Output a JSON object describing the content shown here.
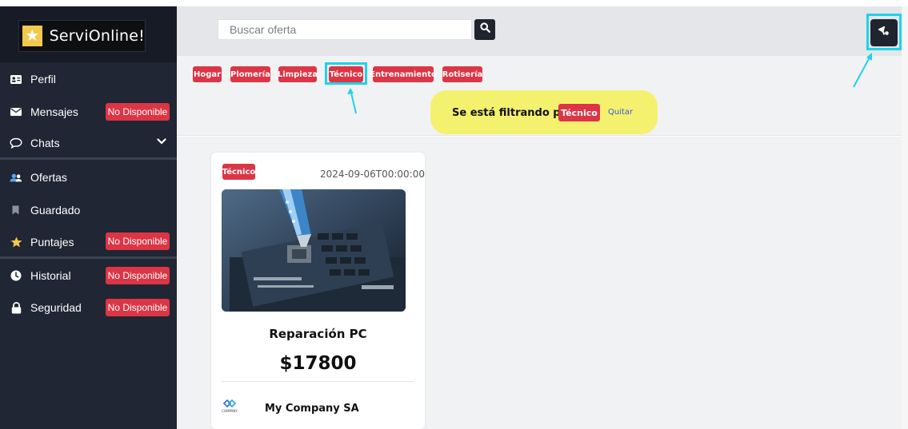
{
  "app": {
    "name": "ServiOnline!"
  },
  "colors": {
    "sidebar": "#202633",
    "accent": "#dc3545",
    "highlight_cyan": "#1dd3e8",
    "highlight_yellow": "#f4f16f"
  },
  "sidebar": {
    "items": [
      {
        "label": "Perfil",
        "icon": "id-card-icon"
      },
      {
        "label": "Mensajes",
        "icon": "envelope-icon",
        "badge": "No Disponible"
      },
      {
        "label": "Chats",
        "icon": "chat-bubble-icon"
      },
      {
        "label": "Ofertas",
        "icon": "users-icon"
      },
      {
        "label": "Guardado",
        "icon": "bookmark-icon"
      },
      {
        "label": "Puntajes",
        "icon": "star-icon",
        "badge": "No Disponible"
      },
      {
        "label": "Historial",
        "icon": "clock-icon",
        "badge": "No Disponible"
      },
      {
        "label": "Seguridad",
        "icon": "lock-icon",
        "badge": "No Disponible"
      }
    ]
  },
  "search": {
    "placeholder": "Buscar oferta"
  },
  "categories": [
    "Hogar",
    "Plomería",
    "Limpieza",
    "Técnico",
    "Entrenamiento",
    "Rotisería"
  ],
  "filter": {
    "text": "Se está filtrando por",
    "value": "Técnico",
    "remove_label": "Quitar"
  },
  "card": {
    "category": "Técnico",
    "date": "2024-09-06T00:00:00",
    "title": "Reparación PC",
    "price": "$17800",
    "company": "My Company SA",
    "company_logo_text": "COMPANY"
  }
}
